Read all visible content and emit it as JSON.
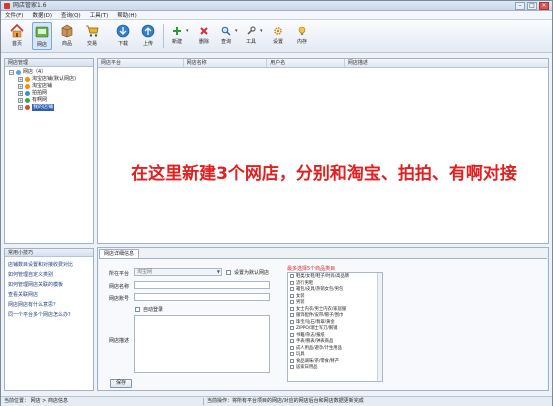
{
  "window": {
    "title": "网店管家1.6"
  },
  "menu": [
    "文件(F)",
    "数据(D)",
    "查询(Q)",
    "工具(T)",
    "帮助(H)"
  ],
  "toolbar": {
    "home": "首页",
    "shop": "网店",
    "goods": "商品",
    "trade": "交易",
    "download": "下载",
    "upload": "上传",
    "new": "新建",
    "delete": "删除",
    "query": "查询",
    "tools": "工具",
    "settings": "设置",
    "exit": "内存"
  },
  "tree": {
    "header": "网店管理",
    "root": "网店（4）",
    "items": [
      "淘宝店铺(默认网店)",
      "淘宝店铺",
      "拍拍网",
      "有啊网",
      "我的店铺"
    ]
  },
  "help": {
    "header": "常用小技巧",
    "items": [
      "店铺数目设置和对接收费对比",
      "如何管理自定义类别",
      "如何管理网店关联的模板",
      "查看关联网店",
      "网店网店有什么意思？",
      "同一个平台多个网店怎么办？"
    ]
  },
  "grid": {
    "columns": [
      "网店平台",
      "网店名称",
      "用户名",
      "网店描述"
    ],
    "overlay": "在这里新建3个网店，分别和淘宝、拍拍、有啊对接"
  },
  "detail": {
    "tab": "网店详细信息",
    "platform_label": "所在平台",
    "platform_value": "淘宝网",
    "default_checkbox": "设置为默认网店",
    "name_label": "网店名称",
    "account_label": "网店账号",
    "auto_login": "自动登录",
    "desc_label": "网店描述",
    "category_title": "最多选择5个商品类目",
    "categories": [
      "鞋类/女鞋/鞋子/时尚/高品牌",
      "流行男鞋",
      "箱包/皮具/热销女包/男包",
      "女装",
      "男装",
      "女士内衣/男士内衣/家居服",
      "服饰配件/皮带/帽子/围巾",
      "珠宝/钻石/翡翠/黄金",
      "ZIPPO/瑞士军刀/眼镜",
      "书籍/杂志/报纸",
      "手表/腕表/钟表商品",
      "成人用品/避孕/计生用品",
      "玩具",
      "食品调味/茶/零食/特产",
      "居家日用品"
    ],
    "save": "保存"
  },
  "status": {
    "left": "当前位置：  网店 > 商店信息",
    "right": "当前操作：将所有平台项目的网店/对应的网店后台和网店数据更新完成"
  }
}
